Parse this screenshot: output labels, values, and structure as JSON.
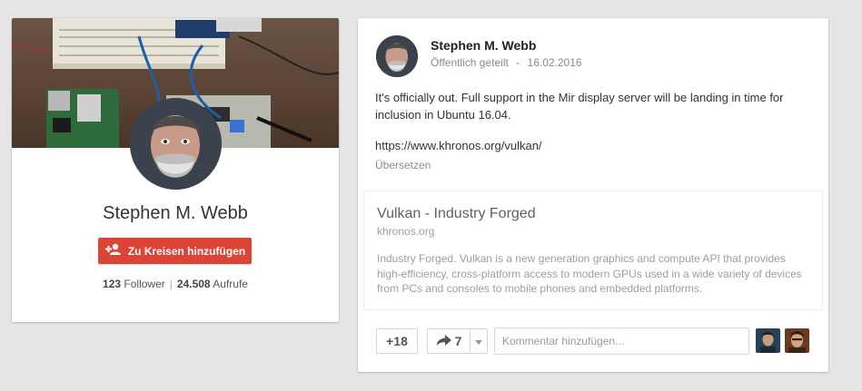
{
  "profile": {
    "name": "Stephen M. Webb",
    "add_button_label": "Zu Kreisen hinzufügen",
    "followers_count": "123",
    "followers_label": "Follower",
    "views_count": "24.508",
    "views_label": "Aufrufe",
    "separator": "|"
  },
  "post": {
    "author": "Stephen M. Webb",
    "visibility": "Öffentlich geteilt",
    "meta_separator": "-",
    "date": "16.02.2016",
    "text": "It's officially out. Full support in the Mir display server will be landing in time for inclusion in Ubuntu 16.04.",
    "link": "https://www.khronos.org/vulkan/",
    "translate_label": "Übersetzen",
    "preview": {
      "title": "Vulkan - Industry Forged",
      "domain": "khronos.org",
      "description": "Industry Forged. Vulkan is a new generation graphics and compute API that provides high-efficiency, cross-platform access to modern GPUs used in a wide variety of devices from PCs and consoles to mobile phones and embedded platforms."
    },
    "plus_one_label": "+18",
    "share_count": "7",
    "comment_placeholder": "Kommentar hinzufügen..."
  },
  "colors": {
    "accent_red": "#db4437",
    "page_background": "#e5e5e5"
  },
  "icons": {
    "add_person": "person-add-icon",
    "share": "share-arrow-icon",
    "dropdown": "caret-down-icon"
  }
}
